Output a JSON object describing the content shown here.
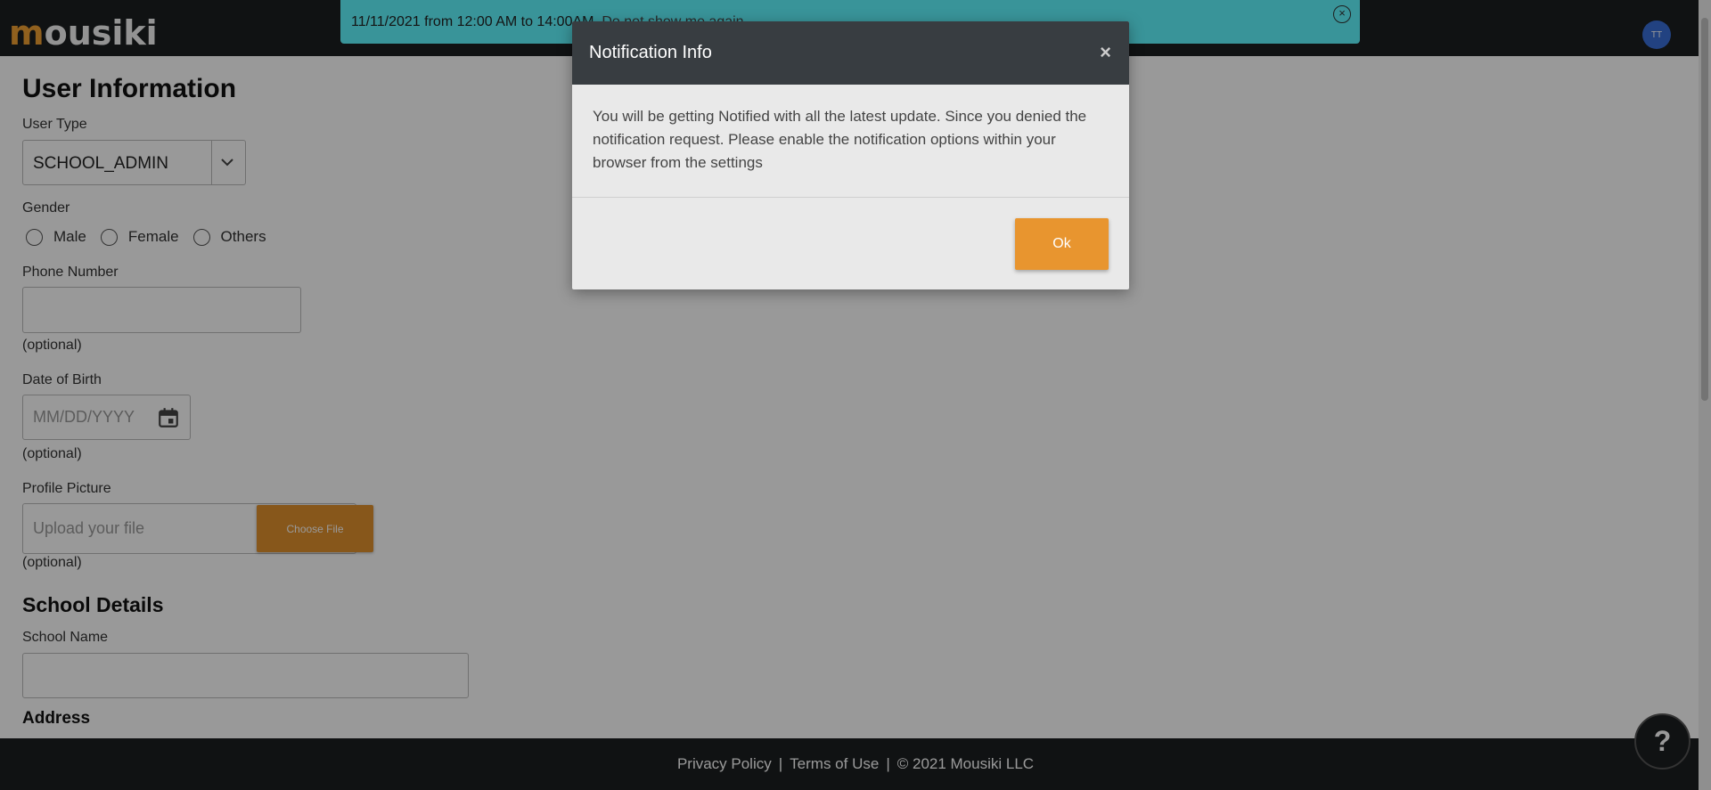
{
  "header": {
    "logo_first": "m",
    "logo_rest": "ousiki",
    "avatar_initials": "TT"
  },
  "announcement": {
    "text": "11/11/2021 from 12:00 AM to 14:00AM.",
    "link": "Do not show me again"
  },
  "form": {
    "title": "User Information",
    "user_type_label": "User Type",
    "user_type_value": "SCHOOL_ADMIN",
    "gender_label": "Gender",
    "gender_options": [
      "Male",
      "Female",
      "Others"
    ],
    "phone_label": "Phone Number",
    "phone_optional": "(optional)",
    "dob_label": "Date of Birth",
    "dob_placeholder": "MM/DD/YYYY",
    "dob_optional": "(optional)",
    "profile_label": "Profile Picture",
    "profile_placeholder": "Upload your file",
    "choose_file": "Choose File",
    "profile_optional": "(optional)",
    "school_section": "School Details",
    "school_name_label": "School Name",
    "address_section": "Address"
  },
  "footer": {
    "privacy": "Privacy Policy",
    "terms": "Terms of Use",
    "copyright": "© 2021 Mousiki LLC",
    "separator": "|"
  },
  "help_label": "?",
  "modal": {
    "title": "Notification Info",
    "close": "×",
    "body": "You will be getting Notified with all the latest update. Since you denied the notification request. Please enable the notification options within your browser from the settings",
    "ok": "Ok"
  },
  "colors": {
    "brand_orange": "#e8952f",
    "nav_dark": "#1b1e21",
    "announce_cyan": "#5ff7ff"
  }
}
